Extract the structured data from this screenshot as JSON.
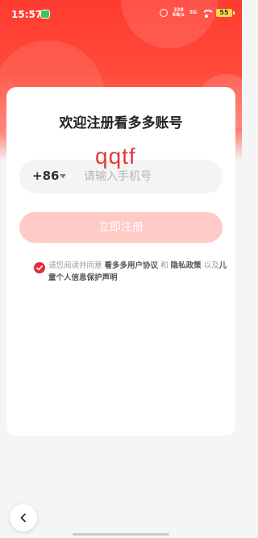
{
  "status_bar": {
    "time": "15:57",
    "net_speed_value": "338",
    "net_speed_unit": "KB/s",
    "sim_label": "5G",
    "battery": "55"
  },
  "register": {
    "title": "欢迎注册看多多账号",
    "country_code": "+86",
    "phone_placeholder": "请输入手机号",
    "submit_label": "立即注册",
    "watermark": "qqtf"
  },
  "agreement": {
    "checked": true,
    "prefix": "请您阅读并同意 ",
    "user_agreement": "看多多用户协议",
    "and": " 和 ",
    "privacy_policy": "隐私政策",
    "and2": " 以及",
    "child_policy": "儿童个人信息保护声明"
  },
  "colors": {
    "brand_red": "#ff3b30",
    "button_disabled": "#ffc9c6",
    "checkbox_red": "#e02e3d"
  },
  "icons": [
    "wechat-icon",
    "alarm-icon",
    "wifi-icon",
    "battery-icon",
    "check-icon",
    "back-arrow-icon",
    "country-caret-icon"
  ]
}
